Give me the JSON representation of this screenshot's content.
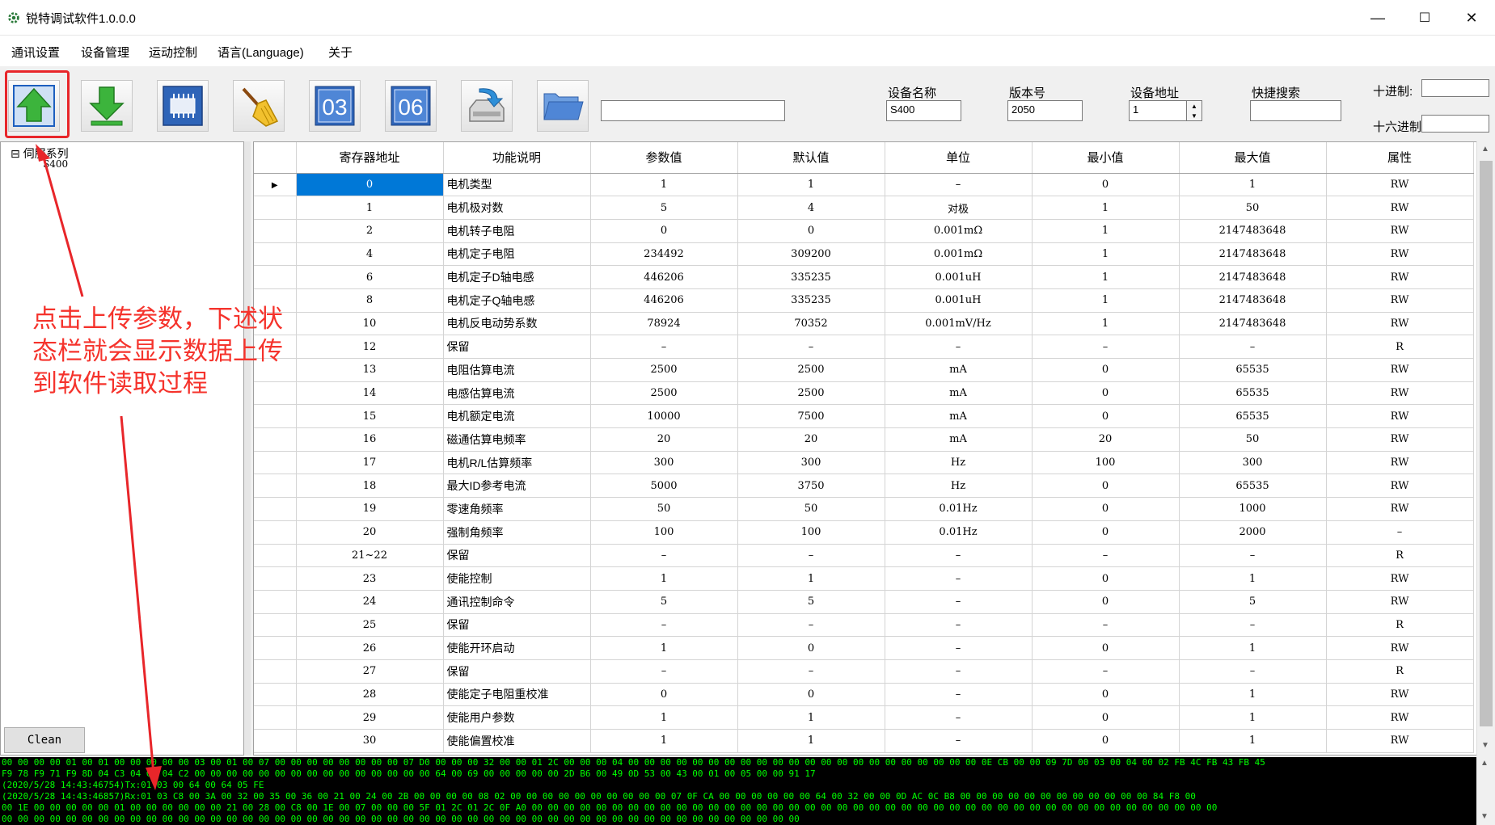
{
  "window": {
    "title": "锐特调试软件1.0.0.0",
    "minimize": "—",
    "maximize": "☐",
    "close": "✕"
  },
  "menu": [
    "通讯设置",
    "设备管理",
    "运动控制",
    "语言(Language)",
    "关于"
  ],
  "toolbar": {
    "buttons": [
      "upload-params",
      "download-params",
      "chip",
      "clear-broom",
      "read-03",
      "write-06",
      "save-disk",
      "open-folder"
    ],
    "read_code": "03",
    "write_code": "06"
  },
  "device": {
    "name_label": "设备名称",
    "name_value": "S400",
    "version_label": "版本号",
    "version_value": "2050",
    "address_label": "设备地址",
    "address_value": "1",
    "search_label": "快捷搜索",
    "decimal_label": "十进制:",
    "hex_label": "十六进制"
  },
  "tree": {
    "root": "伺服系列",
    "root_toggle": "⊟",
    "child": "S400"
  },
  "clean_label": "Clean",
  "grid": {
    "columns": [
      "寄存器地址",
      "功能说明",
      "参数值",
      "默认值",
      "单位",
      "最小值",
      "最大值",
      "属性"
    ],
    "rows": [
      [
        "0",
        "电机类型",
        "1",
        "1",
        "–",
        "0",
        "1",
        "RW"
      ],
      [
        "1",
        "电机极对数",
        "5",
        "4",
        "对极",
        "1",
        "50",
        "RW"
      ],
      [
        "2",
        "电机转子电阻",
        "0",
        "0",
        "0.001mΩ",
        "1",
        "2147483648",
        "RW"
      ],
      [
        "4",
        "电机定子电阻",
        "234492",
        "309200",
        "0.001mΩ",
        "1",
        "2147483648",
        "RW"
      ],
      [
        "6",
        "电机定子D轴电感",
        "446206",
        "335235",
        "0.001uH",
        "1",
        "2147483648",
        "RW"
      ],
      [
        "8",
        "电机定子Q轴电感",
        "446206",
        "335235",
        "0.001uH",
        "1",
        "2147483648",
        "RW"
      ],
      [
        "10",
        "电机反电动势系数",
        "78924",
        "70352",
        "0.001mV/Hz",
        "1",
        "2147483648",
        "RW"
      ],
      [
        "12",
        "保留",
        "–",
        "–",
        "–",
        "–",
        "–",
        "R"
      ],
      [
        "13",
        "电阻估算电流",
        "2500",
        "2500",
        "mA",
        "0",
        "65535",
        "RW"
      ],
      [
        "14",
        "电感估算电流",
        "2500",
        "2500",
        "mA",
        "0",
        "65535",
        "RW"
      ],
      [
        "15",
        "电机额定电流",
        "10000",
        "7500",
        "mA",
        "0",
        "65535",
        "RW"
      ],
      [
        "16",
        "磁通估算电频率",
        "20",
        "20",
        "mA",
        "20",
        "50",
        "RW"
      ],
      [
        "17",
        "电机R/L估算频率",
        "300",
        "300",
        "Hz",
        "100",
        "300",
        "RW"
      ],
      [
        "18",
        "最大ID参考电流",
        "5000",
        "3750",
        "Hz",
        "0",
        "65535",
        "RW"
      ],
      [
        "19",
        "零速角频率",
        "50",
        "50",
        "0.01Hz",
        "0",
        "1000",
        "RW"
      ],
      [
        "20",
        "强制角频率",
        "100",
        "100",
        "0.01Hz",
        "0",
        "2000",
        "–"
      ],
      [
        "21~22",
        "保留",
        "–",
        "–",
        "–",
        "–",
        "–",
        "R"
      ],
      [
        "23",
        "使能控制",
        "1",
        "1",
        "–",
        "0",
        "1",
        "RW"
      ],
      [
        "24",
        "通讯控制命令",
        "5",
        "5",
        "–",
        "0",
        "5",
        "RW"
      ],
      [
        "25",
        "保留",
        "–",
        "–",
        "–",
        "–",
        "–",
        "R"
      ],
      [
        "26",
        "使能开环启动",
        "1",
        "0",
        "–",
        "0",
        "1",
        "RW"
      ],
      [
        "27",
        "保留",
        "–",
        "–",
        "–",
        "–",
        "–",
        "R"
      ],
      [
        "28",
        "使能定子电阻重校准",
        "0",
        "0",
        "–",
        "0",
        "1",
        "RW"
      ],
      [
        "29",
        "使能用户参数",
        "1",
        "1",
        "–",
        "0",
        "1",
        "RW"
      ],
      [
        "30",
        "使能偏置校准",
        "1",
        "1",
        "–",
        "0",
        "1",
        "RW"
      ]
    ]
  },
  "console": [
    "00 00 00 00 01 00 01 00 00 00 00 00 03 00 01 00 07 00 00 00 00 00 00 00 00 07 D0 00 00 00 32 00 00 01 2C 00 00 00 04 00 00 00 00 00 00 00 00 00 00 00 00 00 00 00 00 00 00 00 00 00 00 0E CB 00 00 09 7D 00 03 00 04 00 02 FB 4C FB 43 FB 45",
    "F9 78 F9 71 F9 8D 04 C3 04 C2 04 C2 00 00 00 00 00 00 00 00 00 00 00 00 00 00 00 64 00 69 00 00 00 00 00 2D B6 00 49 0D 53 00 43 00 01 00 05 00 00 91 17",
    "(2020/5/28 14:43:46754)Tx:01 03 00 64 00 64 05 FE",
    "(2020/5/28 14:43:46857)Rx:01 03 C8 00 3A 00 32 00 35 00 36 00 21 00 24 00 2B 00 00 00 00 08 02 00 00 00 00 00 00 00 00 00 00 07 0F CA 00 00 00 00 00 00 64 00 32 00 00 0D AC 0C B8 00 00 00 00 00 00 00 00 00 00 00 00 84 F8 00",
    "00 1E 00 00 00 00 00 01 00 00 00 00 00 00 21 00 28 00 C8 00 1E 00 07 00 00 00 5F 01 2C 01 2C 0F A0 00 00 00 00 00 00 00 00 00 00 00 00 00 00 00 00 00 00 00 00 00 00 00 00 00 00 00 00 00 00 00 00 00 00 00 00 00 00 00 00 00 00 00",
    "00 00 00 00 00 00 00 00 00 00 00 00 00 00 00 00 00 00 00 00 00 00 00 00 00 00 00 00 00 00 00 00 00 00 00 00 00 00 00 00 00 00 00 00 00 00 00 00 00 00"
  ],
  "annotation": {
    "text": "点击上传参数，下述状态栏就会显示数据上传到软件读取过程",
    "color": "#f5332c"
  },
  "colors": {
    "selection": "#0078d7",
    "console_text": "#00ff00",
    "console_bg": "#000000",
    "annotation": "#e8262a"
  }
}
